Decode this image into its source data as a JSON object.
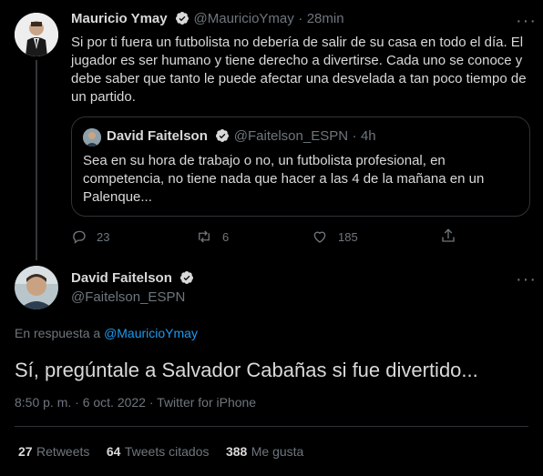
{
  "first_tweet": {
    "author_name": "Mauricio Ymay",
    "handle": "@MauricioYmay",
    "separator": "·",
    "time": "28min",
    "text": "Si por ti fuera un futbolista no debería de salir de su casa en todo el día. El jugador es ser humano y tiene derecho a divertirse. Cada uno se conoce y debe saber que tanto le puede afectar una desvelada a tan poco tiempo de un partido.",
    "quote": {
      "author_name": "David Faitelson",
      "handle": "@Faitelson_ESPN",
      "separator": "·",
      "time": "4h",
      "text": "Sea en su hora de trabajo o no, un futbolista profesional, en competencia, no tiene nada que hacer a las 4 de la mañana en un Palenque..."
    },
    "actions": {
      "replies": "23",
      "retweets": "6",
      "likes": "185"
    }
  },
  "main_tweet": {
    "author_name": "David Faitelson",
    "handle": "@Faitelson_ESPN",
    "reply_prefix": "En respuesta a",
    "reply_to": "@MauricioYmay",
    "text": "Sí, pregúntale a Salvador Cabañas si fue divertido...",
    "timestamp": "8:50 p. m. · 6 oct. 2022 · Twitter for iPhone",
    "stats": {
      "retweets_count": "27",
      "retweets_label": "Retweets",
      "quotes_count": "64",
      "quotes_label": "Tweets citados",
      "likes_count": "388",
      "likes_label": "Me gusta"
    }
  },
  "colors": {
    "background": "#000000",
    "text": "#d9d9d9",
    "muted": "#6e767d",
    "link": "#1d9bf0",
    "border": "#2f3336"
  },
  "icons": [
    "verified-badge-icon",
    "more-options-icon",
    "reply-icon",
    "retweet-icon",
    "like-icon",
    "share-icon"
  ]
}
